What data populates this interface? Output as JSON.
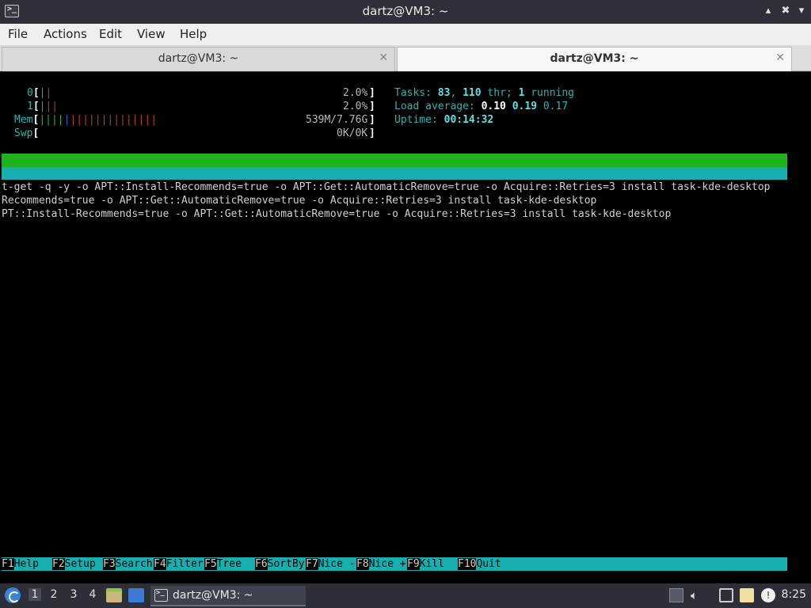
{
  "window": {
    "title": "dartz@VM3: ~",
    "controls": {
      "minimize": "▴",
      "restore": "✖",
      "maximize": "▾"
    }
  },
  "menubar": [
    "File",
    "Actions",
    "Edit",
    "View",
    "Help"
  ],
  "tabs": [
    {
      "label": "dartz@VM3: ~",
      "active": false
    },
    {
      "label": "dartz@VM3: ~",
      "active": true
    }
  ],
  "htop": {
    "cpu": [
      {
        "id": "0",
        "percent": "2.0%"
      },
      {
        "id": "1",
        "percent": "2.0%"
      }
    ],
    "mem": {
      "label": "Mem",
      "value": "539M/7.76G"
    },
    "swp": {
      "label": "Swp",
      "value": "0K/0K"
    },
    "tasks": {
      "label": "Tasks: ",
      "count": "83",
      "sep": ", ",
      "threads": "110",
      "thr_label": " thr; ",
      "running": "1",
      "running_label": " running"
    },
    "load": {
      "label": "Load average: ",
      "v1": "0.10",
      "v2": "0.19",
      "v3": "0.17"
    },
    "uptime": {
      "label": "Uptime: ",
      "value": "00:14:32"
    },
    "process_lines": [
      "t-get -q -y -o APT::Install-Recommends=true -o APT::Get::AutomaticRemove=true -o Acquire::Retries=3 install task-kde-desktop",
      "Recommends=true -o APT::Get::AutomaticRemove=true -o Acquire::Retries=3 install task-kde-desktop",
      "PT::Install-Recommends=true -o APT::Get::AutomaticRemove=true -o Acquire::Retries=3 install task-kde-desktop"
    ],
    "fkeys": [
      {
        "key": "F1",
        "label": "Help  "
      },
      {
        "key": "F2",
        "label": "Setup "
      },
      {
        "key": "F3",
        "label": "Search"
      },
      {
        "key": "F4",
        "label": "Filter"
      },
      {
        "key": "F5",
        "label": "Tree  "
      },
      {
        "key": "F6",
        "label": "SortBy"
      },
      {
        "key": "F7",
        "label": "Nice -"
      },
      {
        "key": "F8",
        "label": "Nice +"
      },
      {
        "key": "F9",
        "label": "Kill  "
      },
      {
        "key": "F10",
        "label": "Quit"
      }
    ]
  },
  "taskbar": {
    "workspaces": [
      "1",
      "2",
      "3",
      "4"
    ],
    "task_label": "dartz@VM3: ~",
    "clock": "8:25"
  }
}
